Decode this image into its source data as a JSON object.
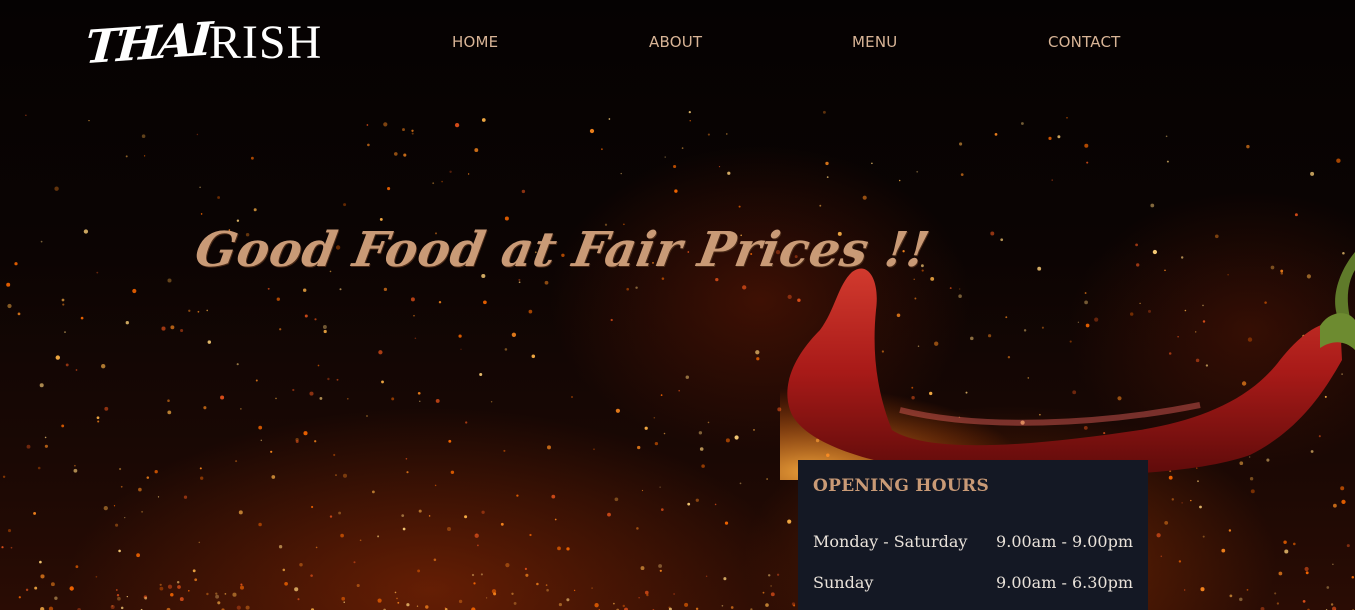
{
  "brand": {
    "logo_part_1": "THAI",
    "logo_part_2": "RISH"
  },
  "nav": {
    "items": [
      {
        "label": "HOME"
      },
      {
        "label": "ABOUT"
      },
      {
        "label": "MENU"
      },
      {
        "label": "CONTACT"
      }
    ]
  },
  "hero": {
    "tagline": "Good Food at Fair Prices !!"
  },
  "opening_hours": {
    "title": "OPENING HOURS",
    "rows": [
      {
        "day": "Monday - Saturday",
        "time": "9.00am - 9.00pm"
      },
      {
        "day": "Sunday",
        "time": "9.00am - 6.30pm"
      }
    ]
  },
  "colors": {
    "accent": "#c99a76",
    "nav_text": "#d8b496",
    "panel_bg": "#141824",
    "chili_red": "#b31f1c",
    "ember": "#ff8a1e"
  }
}
